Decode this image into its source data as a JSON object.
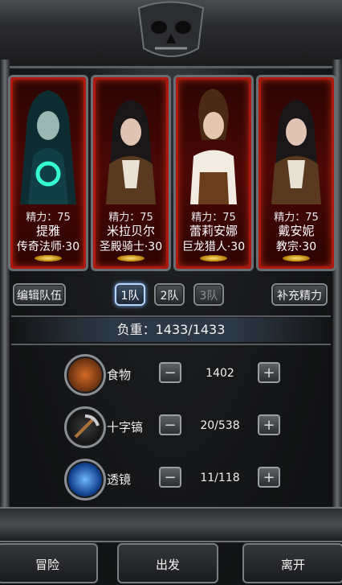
{
  "party": [
    {
      "stamina": "精力：75",
      "name": "提雅",
      "class": "传奇法师·30"
    },
    {
      "stamina": "精力：75",
      "name": "米拉贝尔",
      "class": "圣殿骑士·30"
    },
    {
      "stamina": "精力：75",
      "name": "蕾莉安娜",
      "class": "巨龙猎人·30"
    },
    {
      "stamina": "精力：75",
      "name": "戴安妮",
      "class": "教宗·30"
    }
  ],
  "controls": {
    "edit_team": "编辑队伍",
    "teams": [
      "1队",
      "2队",
      "3队"
    ],
    "active_team": "1队",
    "refill": "补充精力"
  },
  "weight": "负重：1433/1433",
  "items": [
    {
      "label": "食物",
      "qty": "1402",
      "icon": "food-icon"
    },
    {
      "label": "十字镐",
      "qty": "20/538",
      "icon": "pickaxe-icon"
    },
    {
      "label": "透镜",
      "qty": "11/118",
      "icon": "lens-icon"
    }
  ],
  "stepper": {
    "minus": "−",
    "plus": "+"
  },
  "bottom": {
    "adventure": "冒险",
    "depart": "出发",
    "leave": "离开"
  },
  "colors": {
    "card_glow": "#b0170f",
    "active_team": "#b8d5ff"
  }
}
